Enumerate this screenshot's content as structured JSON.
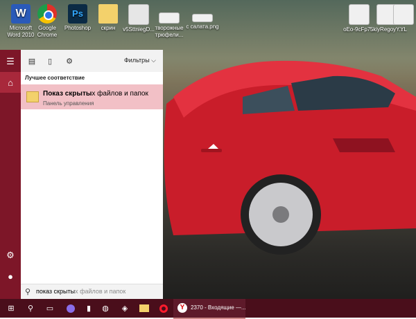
{
  "desktop": {
    "icons": [
      {
        "label_line1": "Microsoft",
        "label_line2": "Word 2010",
        "icon": "word-icon",
        "color": "#2a5ab9"
      },
      {
        "label_line1": "Google",
        "label_line2": "Chrome",
        "icon": "chrome-icon",
        "color": "#e0312a"
      },
      {
        "label_line1": "Photoshop",
        "label_line2": "",
        "icon": "photoshop-icon",
        "color": "#0b2b45"
      },
      {
        "label_line1": "скрин",
        "label_line2": "",
        "icon": "folder-icon",
        "color": "#f3d16b"
      },
      {
        "label_line1": "v5SttniegD...",
        "label_line2": "",
        "icon": "image-file-icon",
        "color": "#e6e6e6"
      },
      {
        "label_line1": "творожные",
        "label_line2": "трюфели...",
        "icon": "image-file-icon",
        "color": "#f0f0f0"
      },
      {
        "label_line1": "с салата.png",
        "label_line2": "",
        "icon": "image-file-icon",
        "color": "#f0f0f0"
      },
      {
        "label_line1": "oEo-9cFp7...",
        "label_line2": "",
        "icon": "image-file-icon",
        "color": "#f0f0f0"
      },
      {
        "label_line1": "5kiyRegoyY...",
        "label_line2": "",
        "icon": "image-file-icon",
        "color": "#f0f0f0"
      },
      {
        "label_line1": "YL",
        "label_line2": "",
        "icon": "image-file-icon",
        "color": "#f0f0f0"
      }
    ]
  },
  "start_panel": {
    "filters_label": "Фильтры",
    "best_match_heading": "Лучшее соответствие",
    "result": {
      "title_bold": "Показ скрыты",
      "title_rest": "х файлов и папок",
      "subtitle": "Панель управления"
    },
    "search": {
      "typed": "показ скрыты",
      "completion": "х файлов и папок"
    }
  },
  "taskbar": {
    "active_window_label": "2370 - Входящие —...",
    "accent": "#7d1628"
  }
}
